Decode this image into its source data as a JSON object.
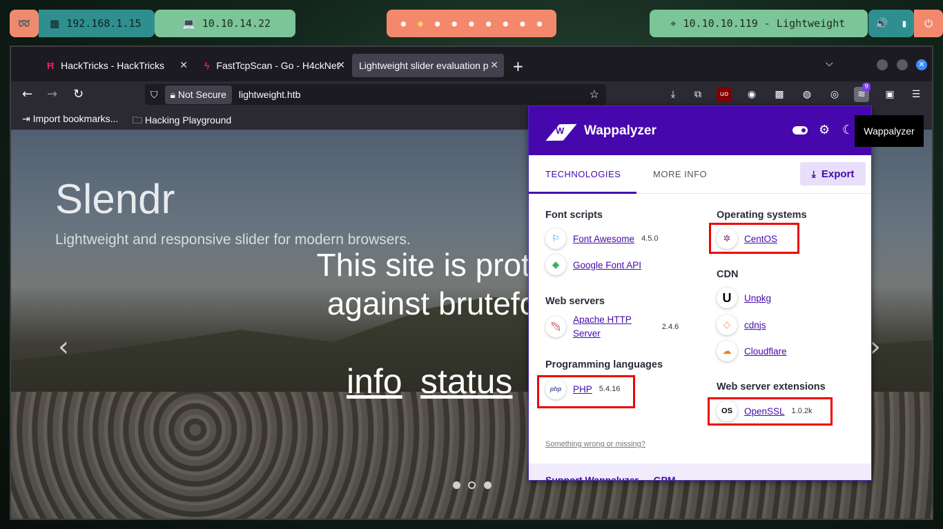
{
  "taskbar": {
    "ip_local": "192.168.1.15",
    "ip_vpn": "10.10.14.22",
    "target": "10.10.10.119 - Lightweight",
    "workspaces": [
      "•",
      "•",
      "•",
      "•",
      "•",
      "•",
      "•",
      "•",
      "•",
      "•"
    ]
  },
  "tabs": [
    {
      "label": "HackTricks - HackTricks"
    },
    {
      "label": "FastTcpScan - Go - H4ckNet"
    },
    {
      "label": "Lightweight slider evaluation page"
    }
  ],
  "navbar": {
    "not_secure": "Not Secure",
    "url": "lightweight.htb",
    "wappalyzer_badge": "9"
  },
  "bookmarks": {
    "import": "Import bookmarks...",
    "hacking": "Hacking Playground"
  },
  "page": {
    "title": "Slendr",
    "subtitle": "Lightweight and responsive slider for modern browsers.",
    "protect_line1": "This site is prote",
    "protect_line2": "against brutefo",
    "link_info": "info",
    "link_status": "status"
  },
  "wappalyzer": {
    "name": "Wappalyzer",
    "tab_tech": "TECHNOLOGIES",
    "tab_more": "MORE INFO",
    "export": "Export",
    "feedback": "Something wrong or missing?",
    "footer": "Support Wappalyzer — GPM",
    "categories": {
      "font_scripts": "Font scripts",
      "web_servers": "Web servers",
      "prog_langs": "Programming languages",
      "os": "Operating systems",
      "cdn": "CDN",
      "web_ext": "Web server extensions"
    },
    "techs": {
      "font_awesome": {
        "name": "Font Awesome",
        "version": "4.5.0"
      },
      "google_font": {
        "name": "Google Font API"
      },
      "apache": {
        "name_l1": "Apache HTTP",
        "name_l2": "Server",
        "version": "2.4.6"
      },
      "php": {
        "name": "PHP",
        "version": "5.4.16"
      },
      "centos": {
        "name": "CentOS"
      },
      "unpkg": {
        "name": "Unpkg"
      },
      "cdnjs": {
        "name": "cdnjs"
      },
      "cloudflare": {
        "name": "Cloudflare"
      },
      "openssl": {
        "name": "OpenSSL",
        "version": "1.0.2k"
      }
    }
  },
  "tooltip": "Wappalyzer"
}
